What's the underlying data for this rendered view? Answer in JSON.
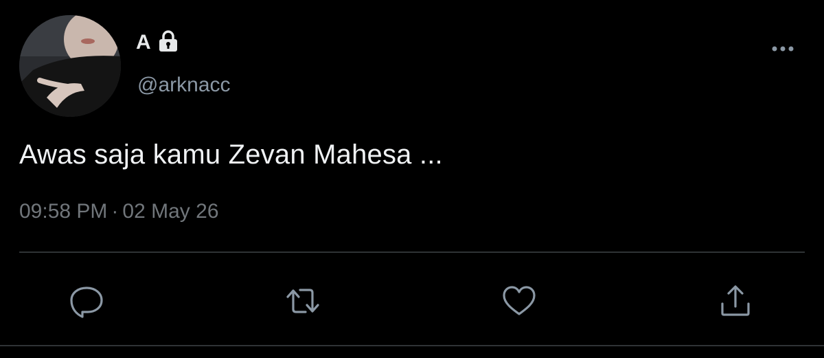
{
  "author": {
    "display_name": "A",
    "handle": "@arknacc",
    "protected": true,
    "avatar": "avatar-photo"
  },
  "tweet": {
    "text": "Awas saja kamu Zevan Mahesa ...",
    "time": "09:58 PM",
    "separator": "·",
    "date": "02 May 26"
  },
  "actions": [
    {
      "name": "reply",
      "icon": "speech-bubble-icon"
    },
    {
      "name": "retweet",
      "icon": "retweet-arrows-icon"
    },
    {
      "name": "like",
      "icon": "heart-outline-icon"
    },
    {
      "name": "share",
      "icon": "share-upload-icon"
    }
  ],
  "menu": {
    "icon": "more-horizontal-icon"
  },
  "colors": {
    "background": "#000000",
    "text_primary": "#e7e9ea",
    "text_secondary": "#71767b",
    "divider": "#2f3336",
    "icon": "#8b98a5"
  }
}
